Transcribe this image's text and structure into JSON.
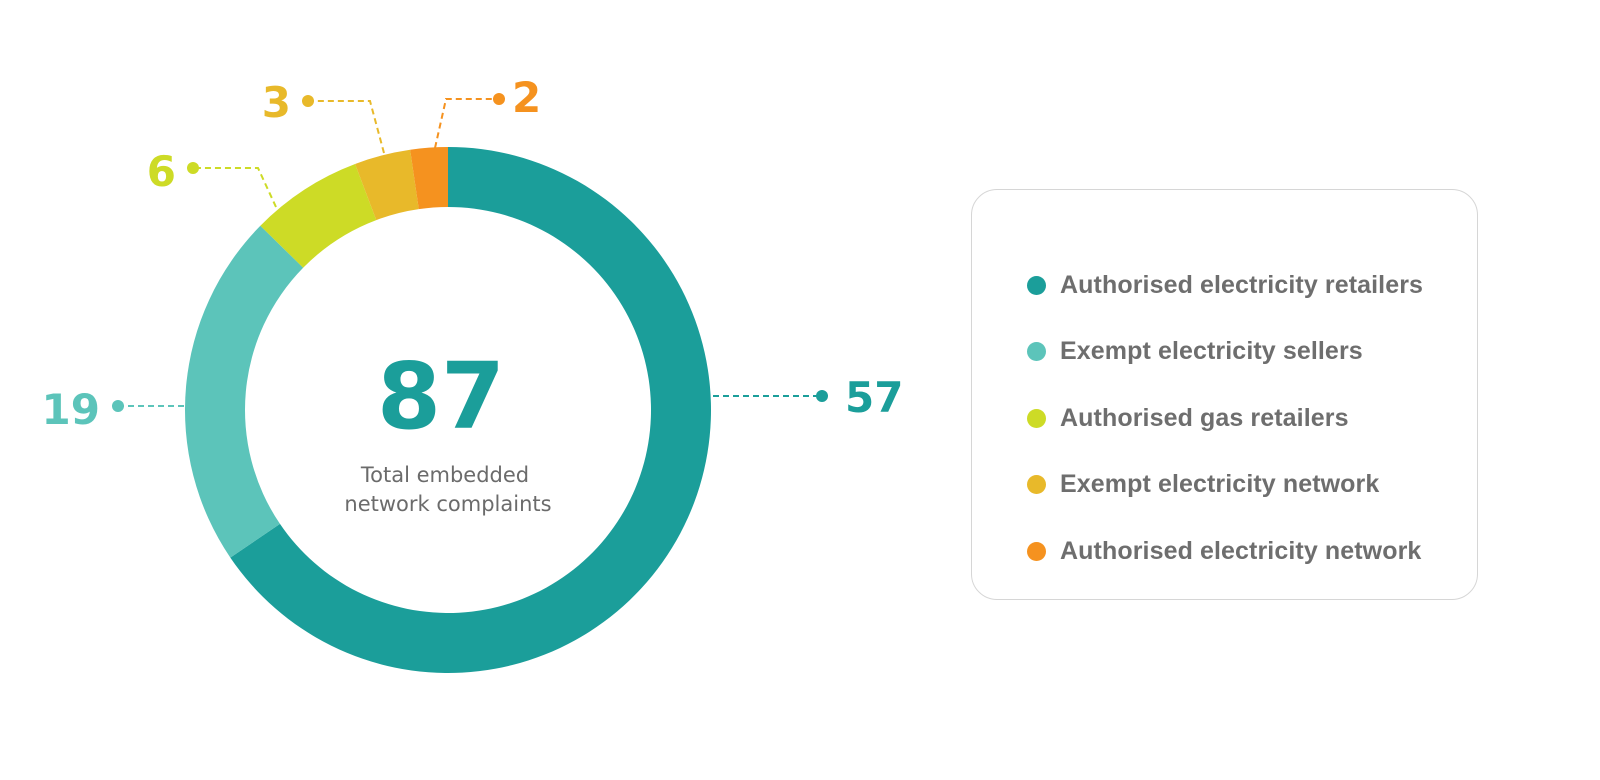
{
  "chart_data": {
    "type": "pie",
    "variant": "donut",
    "title": "",
    "total": {
      "value": "87",
      "caption_line1": "Total embedded",
      "caption_line2": "network complaints"
    },
    "categories": [
      "Authorised electricity retailers",
      "Exempt electricity sellers",
      "Authorised gas retailers",
      "Exempt electricity network",
      "Authorised electricity network"
    ],
    "values": [
      57,
      19,
      6,
      3,
      2
    ],
    "colors": [
      "#1b9e9a",
      "#5cc4ba",
      "#cddb26",
      "#e8b92a",
      "#f5921f"
    ],
    "legend_position": "right",
    "slice_order": "clockwise from top"
  },
  "legend": {
    "items": [
      {
        "label": "Authorised electricity retailers",
        "color": "#1b9e9a"
      },
      {
        "label": "Exempt electricity sellers",
        "color": "#5cc4ba"
      },
      {
        "label": "Authorised gas retailers",
        "color": "#cddb26"
      },
      {
        "label": "Exempt electricity network",
        "color": "#e8b92a"
      },
      {
        "label": "Authorised electricity network",
        "color": "#f5921f"
      }
    ]
  }
}
